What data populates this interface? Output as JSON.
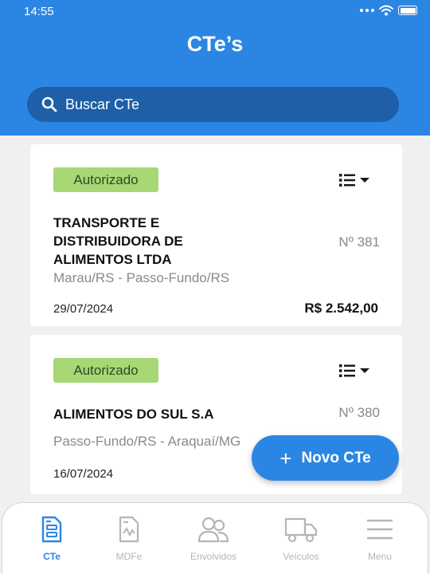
{
  "status_bar": {
    "time": "14:55"
  },
  "header": {
    "title": "CTe’s"
  },
  "search": {
    "placeholder": "Buscar CTe"
  },
  "cards": [
    {
      "status": "Autorizado",
      "company": "TRANSPORTE E DISTRIBUIDORA DE ALIMENTOS LTDA",
      "number": "Nº 381",
      "route": "Marau/RS - Passo-Fundo/RS",
      "date": "29/07/2024",
      "amount": "R$ 2.542,00"
    },
    {
      "status": "Autorizado",
      "company": "ALIMENTOS DO SUL S.A",
      "number": "Nº 380",
      "route": "Passo-Fundo/RS - Araquaí/MG",
      "date": "16/07/2024",
      "amount": ""
    }
  ],
  "fab": {
    "plus": "+",
    "label": "Novo CTe"
  },
  "bottom_nav": [
    {
      "label": "CTe",
      "icon": "cte-document-icon",
      "active": true
    },
    {
      "label": "MDFe",
      "icon": "mdfe-document-icon",
      "active": false
    },
    {
      "label": "Envolvidos",
      "icon": "people-icon",
      "active": false
    },
    {
      "label": "Veículos",
      "icon": "truck-icon",
      "active": false
    },
    {
      "label": "Menu",
      "icon": "hamburger-icon",
      "active": false
    }
  ],
  "colors": {
    "primary": "#2b86e3",
    "search_bg": "#1e5fa8",
    "badge_bg": "#a8d776",
    "inactive": "#b5b5b5"
  }
}
